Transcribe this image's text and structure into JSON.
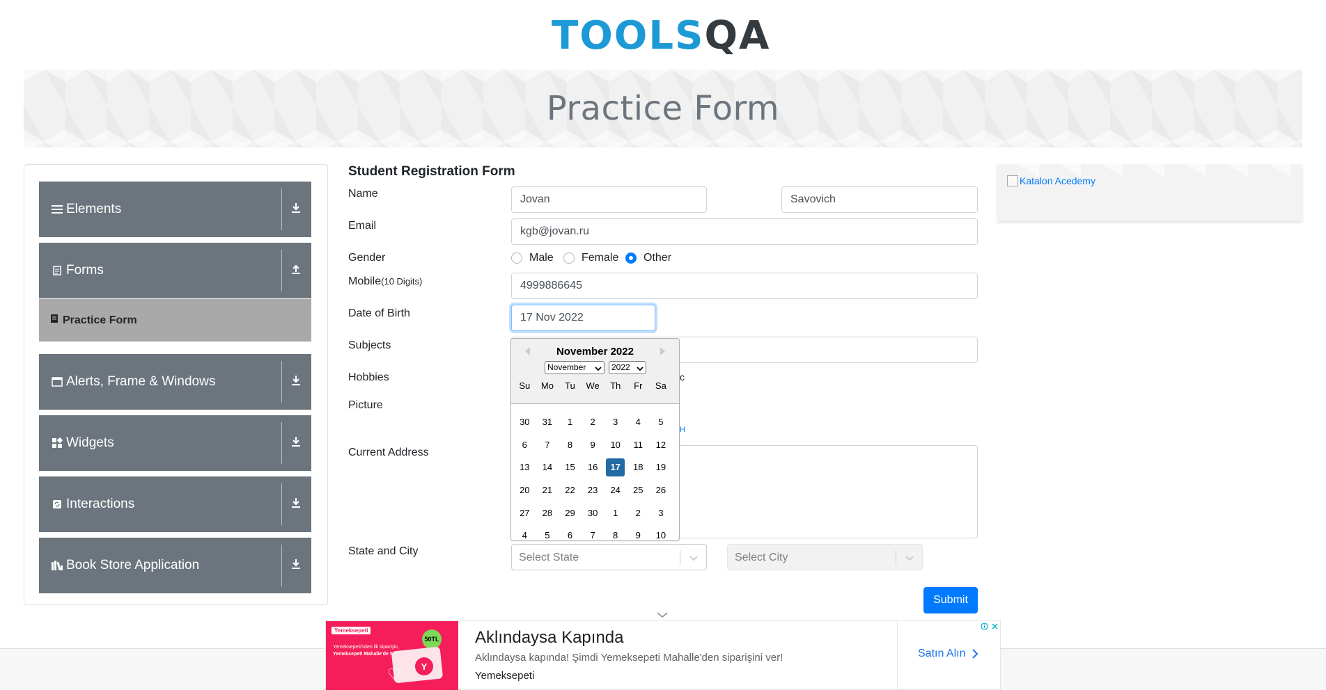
{
  "header": {
    "logo_text_tools": "TOOLS",
    "logo_text_qa": "QA"
  },
  "banner": {
    "title": "Practice Form"
  },
  "sidebar": {
    "groups": [
      {
        "label": "Elements",
        "icon": "menu-icon",
        "arrow": "download-icon"
      },
      {
        "label": "Forms",
        "icon": "document-icon",
        "arrow": "upload-icon"
      },
      {
        "label": "Alerts, Frame & Windows",
        "icon": "window-icon",
        "arrow": "download-icon"
      },
      {
        "label": "Widgets",
        "icon": "widgets-icon",
        "arrow": "download-icon"
      },
      {
        "label": "Interactions",
        "icon": "interactions-icon",
        "arrow": "download-icon"
      },
      {
        "label": "Book Store Application",
        "icon": "books-icon",
        "arrow": "download-icon"
      }
    ],
    "active_item": {
      "label": "Practice Form",
      "icon": "form-icon"
    }
  },
  "form": {
    "title": "Student Registration Form",
    "labels": {
      "name": "Name",
      "email": "Email",
      "gender": "Gender",
      "mobile": "Mobile",
      "mobile_hint": "(10 Digits)",
      "dob": "Date of Birth",
      "subjects": "Subjects",
      "hobbies": "Hobbies",
      "picture": "Picture",
      "address": "Current Address",
      "state_city": "State and City"
    },
    "first_name": "Jovan",
    "last_name": "Savovich",
    "email": "kgb@jovan.ru",
    "gender_options": [
      "Male",
      "Female",
      "Other"
    ],
    "gender_selected": "Other",
    "mobile": "4999886645",
    "dob": "17 Nov 2022",
    "hobbies_partial": "c",
    "picture_partial": "H",
    "state_placeholder": "Select State",
    "city_placeholder": "Select City",
    "submit_label": "Submit"
  },
  "datepicker": {
    "month_title": "November 2022",
    "month_select": "November",
    "year_select": "2022",
    "day_names": [
      "Su",
      "Mo",
      "Tu",
      "We",
      "Th",
      "Fr",
      "Sa"
    ],
    "weeks": [
      [
        "30",
        "31",
        "1",
        "2",
        "3",
        "4",
        "5"
      ],
      [
        "6",
        "7",
        "8",
        "9",
        "10",
        "11",
        "12"
      ],
      [
        "13",
        "14",
        "15",
        "16",
        "17",
        "18",
        "19"
      ],
      [
        "20",
        "21",
        "22",
        "23",
        "24",
        "25",
        "26"
      ],
      [
        "27",
        "28",
        "29",
        "30",
        "1",
        "2",
        "3"
      ],
      [
        "4",
        "5",
        "6",
        "7",
        "8",
        "9",
        "10"
      ]
    ],
    "selected_day": "17",
    "selected_color": "#216ba5"
  },
  "ad_right": {
    "alt_text": "Katalon Acedemy"
  },
  "ad_bottom": {
    "headline": "Aklındaysa Kapında",
    "description": "Aklındaysa kapında! Şimdi Yemeksepeti Mahalle'den siparişini ver!",
    "brand": "Yemeksepeti",
    "cta": "Satın Alın",
    "image_tag": "Yemeksepeti",
    "image_line1": "Yemeksepeti'nden ilk siparişin,",
    "image_line2": "Yemeksepeti Mahalle'de 50 TL indirimli",
    "image_badge": "50TL",
    "image_y": "Y"
  },
  "colors": {
    "accent": "#007bff",
    "nav_bg": "#6c757d",
    "nav_active_bg": "#a9a9a9",
    "ad_bg": "#f51e5a",
    "logo_blue": "#1d9ad6"
  }
}
